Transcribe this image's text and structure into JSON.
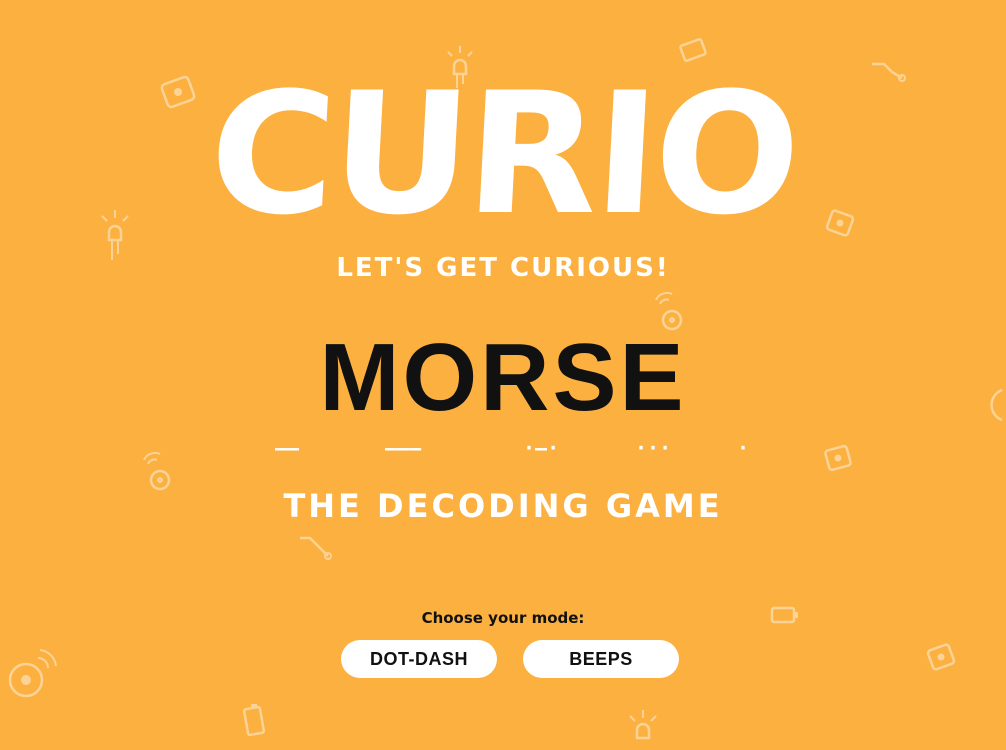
{
  "logo": {
    "text": "CURIO"
  },
  "tagline": "LET'S GET CURIOUS!",
  "game": {
    "title": "MORSE",
    "morse_groups": [
      "‒‒",
      "‒‒‒",
      "·‒·",
      "···",
      "·"
    ],
    "subtitle": "THE DECODING GAME"
  },
  "mode": {
    "prompt": "Choose your mode:",
    "options": [
      "DOT-DASH",
      "BEEPS"
    ]
  },
  "colors": {
    "background": "#FBB040",
    "accent": "#FFFFFF",
    "text": "#111111"
  },
  "decorative_icons": [
    "robot-icon",
    "led-bulb-icon",
    "battery-icon",
    "speaker-icon",
    "wire-icon",
    "sound-wave-icon"
  ]
}
